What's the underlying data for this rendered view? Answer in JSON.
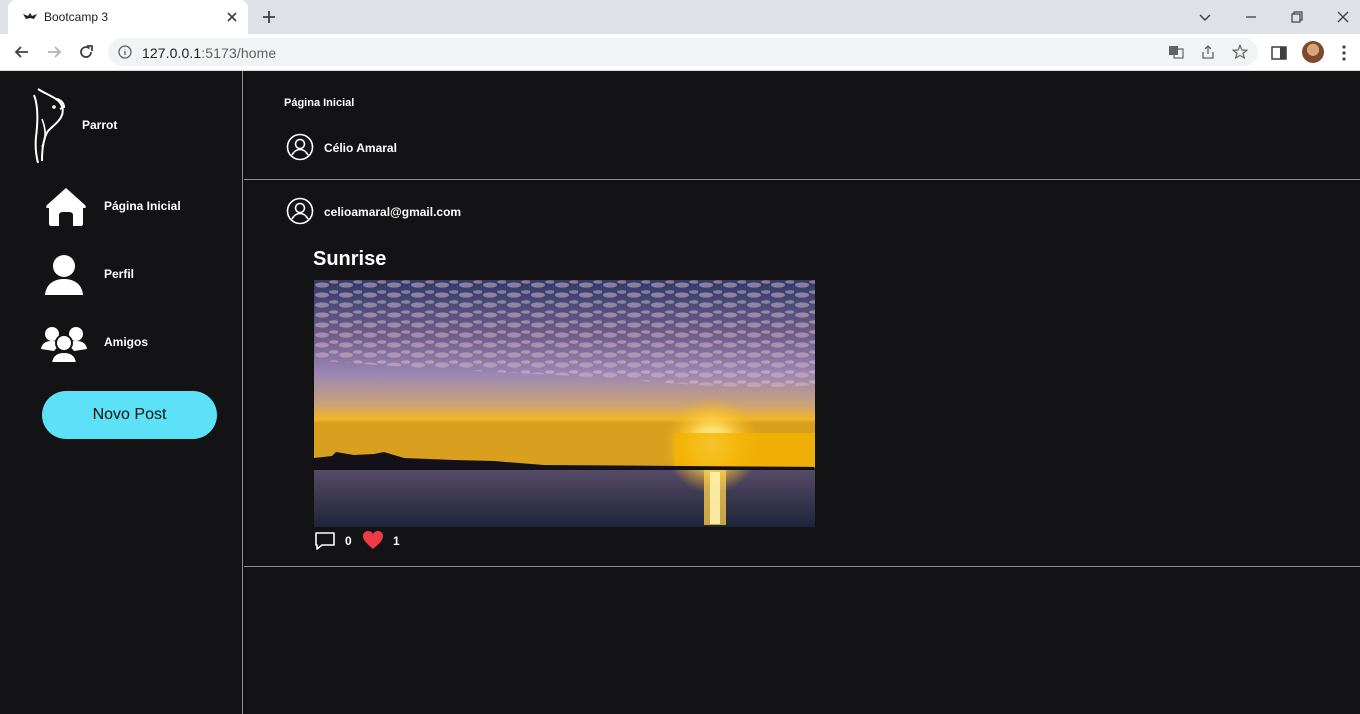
{
  "browser": {
    "tab_title": "Bootcamp 3",
    "url_host": "127.0.0.1",
    "url_rest": ":5173/home"
  },
  "sidebar": {
    "brand": "Parrot",
    "items": [
      {
        "label": "Página Inicial",
        "icon": "home-icon"
      },
      {
        "label": "Perfil",
        "icon": "user-icon"
      },
      {
        "label": "Amigos",
        "icon": "friends-icon"
      }
    ],
    "new_post_label": "Novo Post"
  },
  "main": {
    "page_title": "Página Inicial",
    "current_user": "Célio Amaral",
    "post": {
      "author": "celioamaral@gmail.com",
      "title": "Sunrise",
      "comments": "0",
      "likes": "1"
    }
  },
  "colors": {
    "background": "#131316",
    "accent": "#5ce1f6",
    "like": "#ef3b45"
  }
}
